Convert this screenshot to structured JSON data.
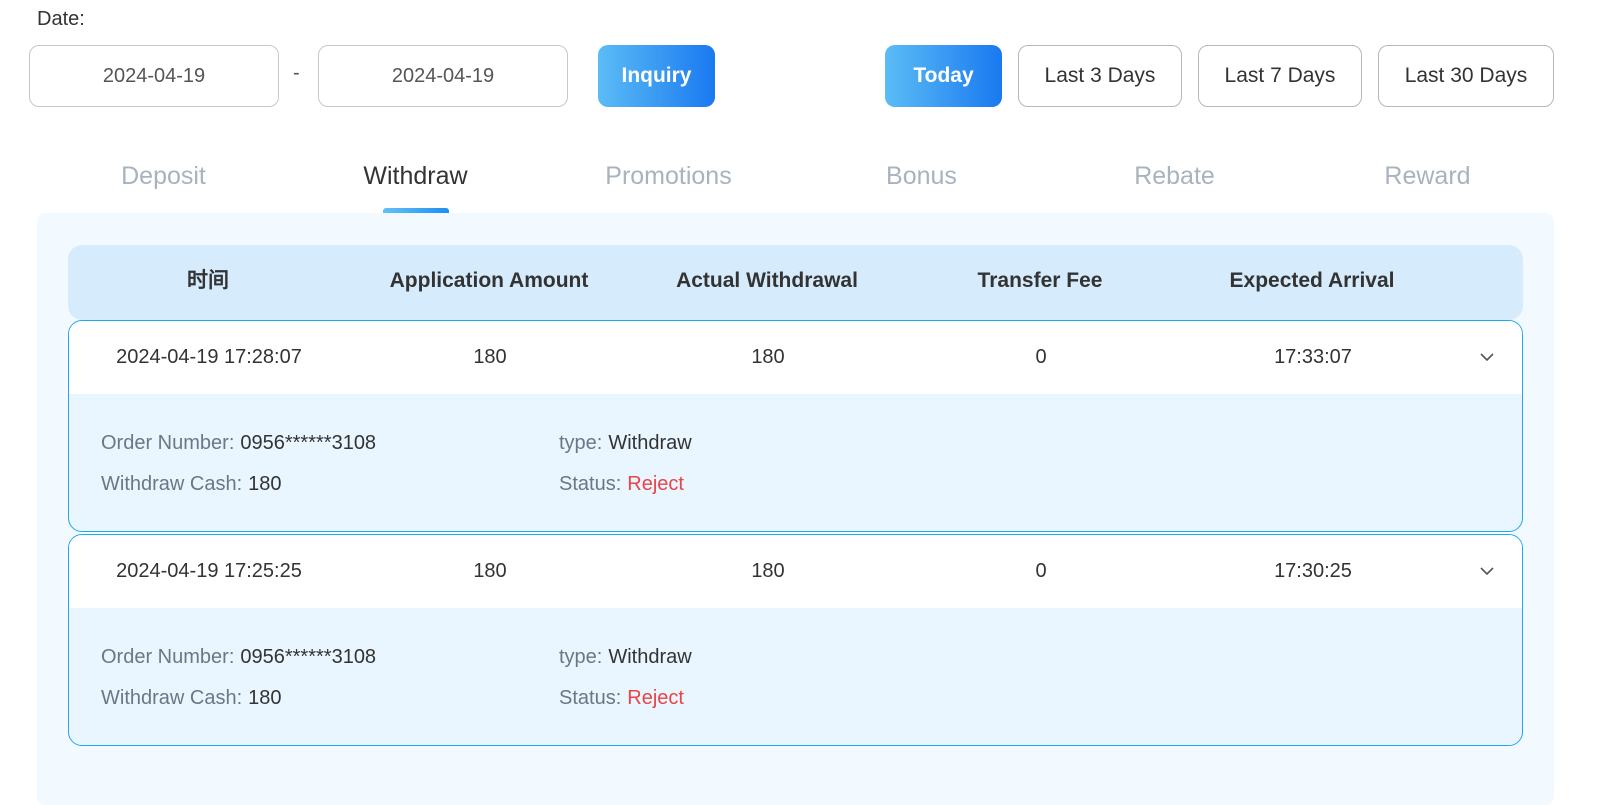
{
  "filter": {
    "date_label": "Date:",
    "start_date": "2024-04-19",
    "end_date": "2024-04-19",
    "separator": "-",
    "inquiry_label": "Inquiry",
    "quick_ranges": {
      "today": "Today",
      "last3": "Last 3 Days",
      "last7": "Last 7 Days",
      "last30": "Last 30 Days"
    },
    "active_range": "Today"
  },
  "tabs": {
    "items": [
      "Deposit",
      "Withdraw",
      "Promotions",
      "Bonus",
      "Rebate",
      "Reward"
    ],
    "active": "Withdraw"
  },
  "table": {
    "headers": [
      "时间",
      "Application Amount",
      "Actual Withdrawal",
      "Transfer Fee",
      "Expected Arrival"
    ],
    "rows": [
      {
        "time": "2024-04-19 17:28:07",
        "application_amount": "180",
        "actual_withdrawal": "180",
        "transfer_fee": "0",
        "expected_arrival": "17:33:07",
        "details": {
          "order_number_label": "Order Number:",
          "order_number": "0956******3108",
          "type_label": "type:",
          "type": "Withdraw",
          "withdraw_cash_label": "Withdraw Cash:",
          "withdraw_cash": "180",
          "status_label": "Status:",
          "status": "Reject"
        }
      },
      {
        "time": "2024-04-19 17:25:25",
        "application_amount": "180",
        "actual_withdrawal": "180",
        "transfer_fee": "0",
        "expected_arrival": "17:30:25",
        "details": {
          "order_number_label": "Order Number:",
          "order_number": "0956******3108",
          "type_label": "type:",
          "type": "Withdraw",
          "withdraw_cash_label": "Withdraw Cash:",
          "withdraw_cash": "180",
          "status_label": "Status:",
          "status": "Reject"
        }
      }
    ]
  },
  "colors": {
    "accent_gradient_start": "#5bbcf6",
    "accent_gradient_end": "#1a79f0",
    "status_reject": "#e84545",
    "row_border": "#22a8e8",
    "header_bg": "#d6ecfd"
  },
  "icons": {
    "expand": "chevron-down-icon"
  }
}
